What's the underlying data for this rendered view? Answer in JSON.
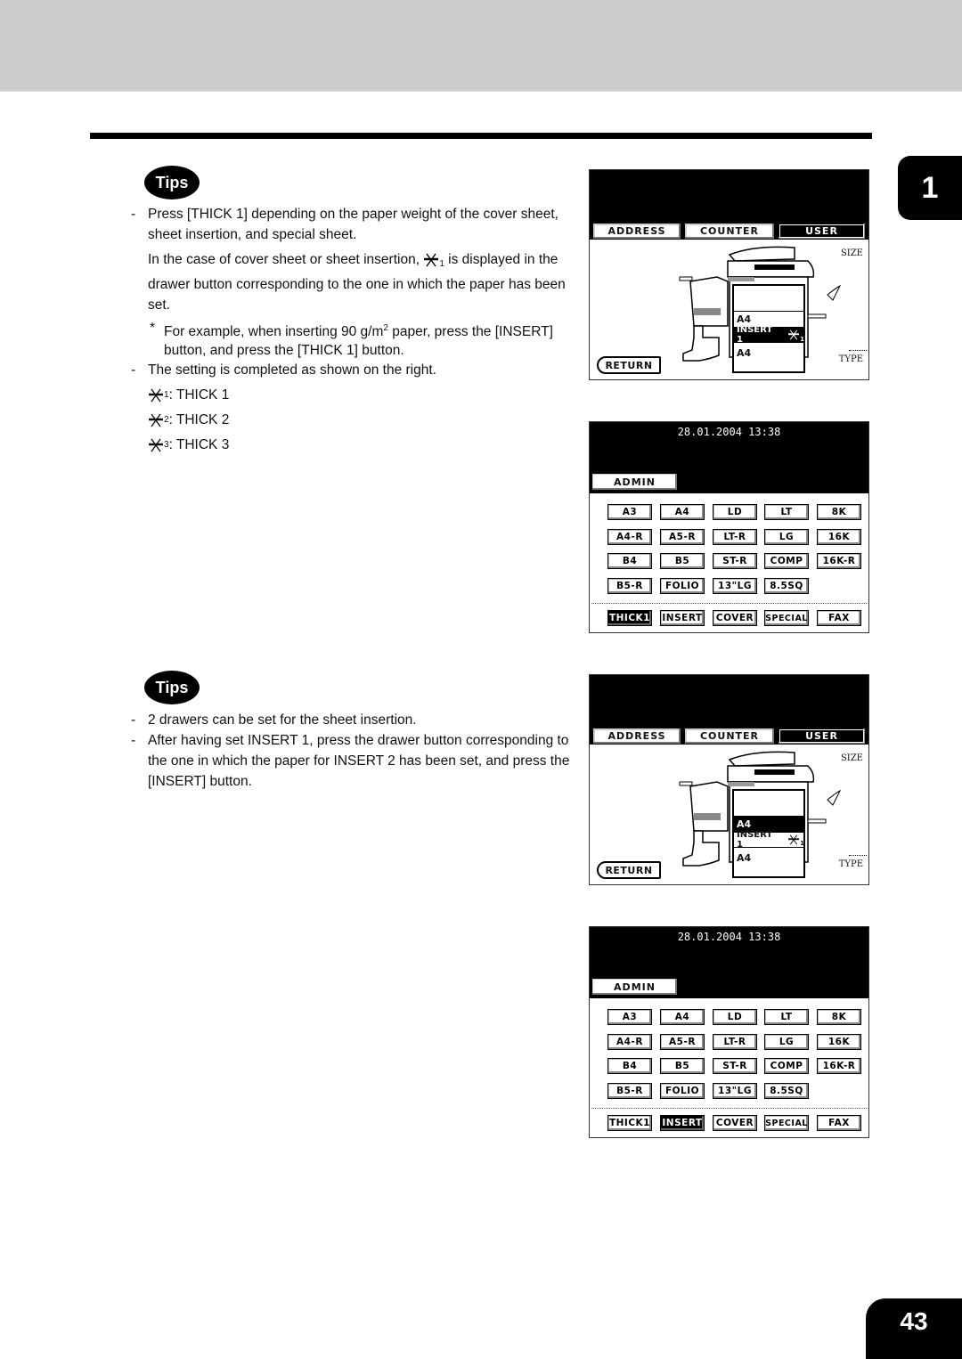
{
  "page": {
    "chapter_number": "1",
    "page_number": "43"
  },
  "tips1": {
    "badge": "Tips",
    "item1_dash": "-",
    "item1": "Press [THICK 1] depending on the paper weight of the cover sheet, sheet insertion, and special sheet.",
    "para_before": "In the case of cover sheet or sheet insertion, ",
    "para_sub": "1",
    "para_after": " is displayed in the drawer button corresponding to the one in which the paper has been set.",
    "note_star": "*",
    "note_before": "For example, when inserting 90 g/m",
    "note_sup": "2",
    "note_after": " paper, press the [INSERT] button, and press the [THICK 1] button.",
    "item2_dash": "-",
    "item2": "The setting is completed as shown on the right.",
    "thick_legend": [
      {
        "sub": "1",
        "label": ": THICK 1"
      },
      {
        "sub": "2",
        "label": ": THICK 2"
      },
      {
        "sub": "3",
        "label": ": THICK 3"
      }
    ]
  },
  "tips2": {
    "badge": "Tips",
    "item1_dash": "-",
    "item1": "2 drawers can be set for the sheet insertion.",
    "item2_dash": "-",
    "item2": "After having set INSERT 1, press the drawer button corresponding to the one in which the paper for INSERT 2 has been set, and press the [INSERT] button."
  },
  "screen_user_1": {
    "tabs": [
      "ADDRESS",
      "COUNTER",
      "USER"
    ],
    "selected_tab": "USER",
    "size_label": "SIZE",
    "type_label": "TYPE",
    "drawer_upper": "A4",
    "drawer_insert": "INSERT 1",
    "drawer_insert_sub": "1",
    "drawer_lower": "A4",
    "highlighted_drawer": "insert",
    "return_label": "RETURN"
  },
  "screen_admin_1": {
    "datetime": "28.01.2004 13:38",
    "admin_label": "ADMIN",
    "size_buttons": [
      [
        "A3",
        "A4",
        "LD",
        "LT",
        "8K"
      ],
      [
        "A4-R",
        "A5-R",
        "LT-R",
        "LG",
        "16K"
      ],
      [
        "B4",
        "B5",
        "ST-R",
        "COMP",
        "16K-R"
      ],
      [
        "B5-R",
        "FOLIO",
        "13\"LG",
        "8.5SQ"
      ]
    ],
    "type_buttons": [
      "THICK1",
      "INSERT",
      "COVER",
      "SPECIAL",
      "FAX"
    ],
    "selected_type": "THICK1"
  },
  "screen_user_2": {
    "tabs": [
      "ADDRESS",
      "COUNTER",
      "USER"
    ],
    "selected_tab": "USER",
    "size_label": "SIZE",
    "type_label": "TYPE",
    "drawer_upper": "A4",
    "drawer_insert": "INSERT 1",
    "drawer_insert_sub": "1",
    "drawer_lower": "A4",
    "highlighted_drawer": "upper",
    "return_label": "RETURN"
  },
  "screen_admin_2": {
    "datetime": "28.01.2004 13:38",
    "admin_label": "ADMIN",
    "size_buttons": [
      [
        "A3",
        "A4",
        "LD",
        "LT",
        "8K"
      ],
      [
        "A4-R",
        "A5-R",
        "LT-R",
        "LG",
        "16K"
      ],
      [
        "B4",
        "B5",
        "ST-R",
        "COMP",
        "16K-R"
      ],
      [
        "B5-R",
        "FOLIO",
        "13\"LG",
        "8.5SQ"
      ]
    ],
    "type_buttons": [
      "THICK1",
      "INSERT",
      "COVER",
      "SPECIAL",
      "FAX"
    ],
    "selected_type": "INSERT"
  }
}
